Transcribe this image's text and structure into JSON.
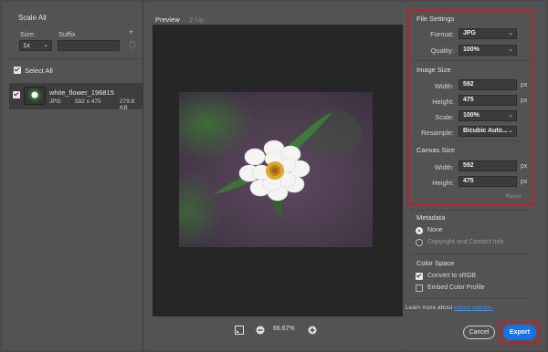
{
  "left_panel": {
    "title": "Scale All",
    "size_label": "Size:",
    "suffix_label": "Suffix",
    "add_symbol": "+",
    "scale_value": "1x",
    "select_all_label": "Select All",
    "file": {
      "name": "white_flower_196815",
      "format": "JPG",
      "dimensions": "592 x 475",
      "size": "279.8 KB"
    }
  },
  "preview": {
    "tabs": [
      "Preview",
      "2-Up"
    ],
    "zoom": "66.67%"
  },
  "file_settings": {
    "title": "File Settings",
    "format_label": "Format:",
    "format_value": "JPG",
    "quality_label": "Quality:",
    "quality_value": "100%"
  },
  "image_size": {
    "title": "Image Size",
    "width_label": "Width:",
    "width_value": "592",
    "height_label": "Height:",
    "height_value": "475",
    "unit": "px",
    "scale_label": "Scale:",
    "scale_value": "100%",
    "resample_label": "Resample:",
    "resample_value": "Bicubic Auto..."
  },
  "canvas_size": {
    "title": "Canvas Size",
    "width_label": "Width:",
    "width_value": "592",
    "height_label": "Height:",
    "height_value": "475",
    "unit": "px",
    "reset_label": "Reset"
  },
  "metadata": {
    "title": "Metadata",
    "options": [
      "None",
      "Copyright and Contact Info"
    ]
  },
  "color_space": {
    "title": "Color Space",
    "convert_label": "Convert to sRGB",
    "embed_label": "Embed Color Profile"
  },
  "footer": {
    "learn_text": "Learn more about",
    "learn_link": "export options.",
    "cancel_label": "Cancel",
    "export_label": "Export"
  },
  "colors": {
    "accent": "#1473e6",
    "highlight_border": "#b3262b"
  }
}
